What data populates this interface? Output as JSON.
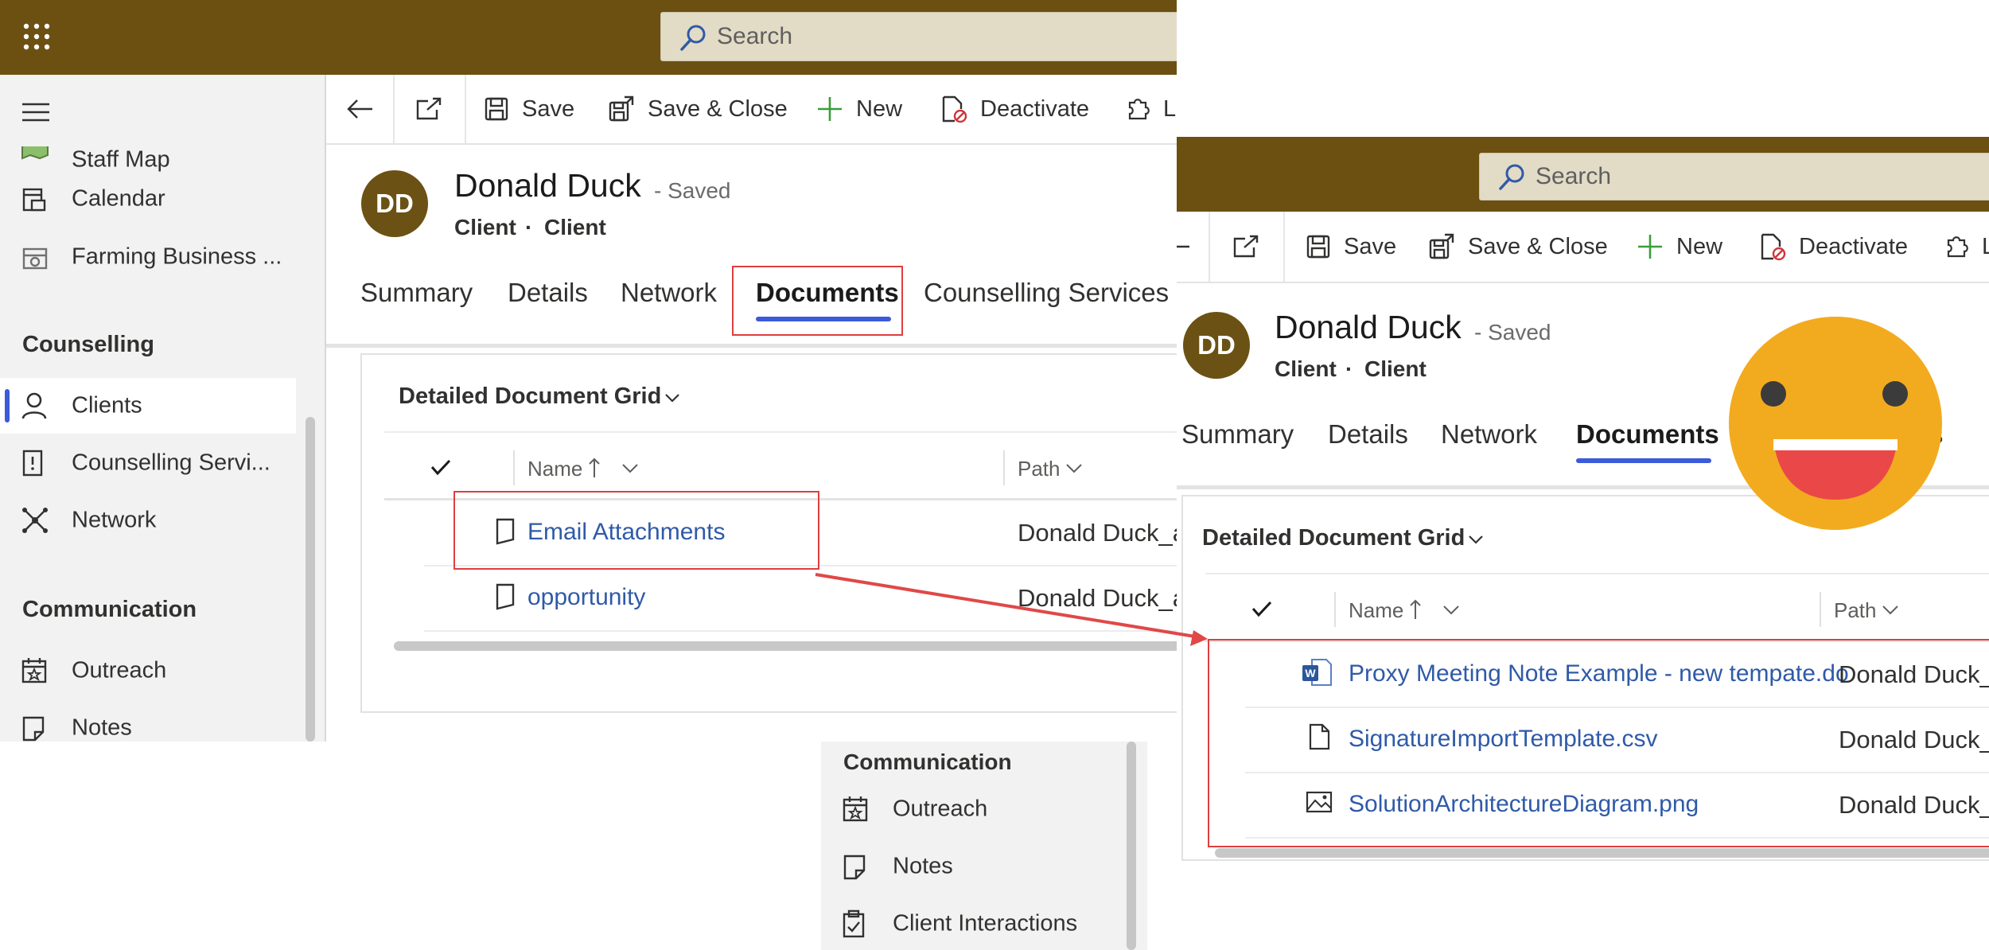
{
  "left": {
    "search_placeholder": "Search",
    "sidebar": {
      "top_items": [
        {
          "label": "Staff Map",
          "icon": "map-icon"
        },
        {
          "label": "Calendar",
          "icon": "calendar-icon"
        },
        {
          "label": "Farming Business ...",
          "icon": "business-icon"
        }
      ],
      "groups": [
        {
          "title": "Counselling",
          "items": [
            {
              "label": "Clients",
              "icon": "person-icon",
              "selected": true
            },
            {
              "label": "Counselling Servi...",
              "icon": "document-alert-icon"
            },
            {
              "label": "Network",
              "icon": "network-icon"
            }
          ]
        },
        {
          "title": "Communication",
          "items": [
            {
              "label": "Outreach",
              "icon": "calendar-star-icon"
            },
            {
              "label": "Notes",
              "icon": "note-icon"
            }
          ]
        }
      ]
    },
    "commands": {
      "save": "Save",
      "save_close": "Save & Close",
      "new": "New",
      "deactivate": "Deactivate",
      "more": "Li"
    },
    "record": {
      "initials": "DD",
      "name": "Donald Duck",
      "saved": "- Saved",
      "entity": "Client",
      "form": "Client",
      "separator": "·"
    },
    "tabs": [
      "Summary",
      "Details",
      "Network",
      "Documents",
      "Counselling Services"
    ],
    "active_tab": "Documents",
    "grid": {
      "title": "Detailed Document Grid",
      "columns": {
        "name": "Name",
        "path": "Path"
      },
      "rows": [
        {
          "name": "Email Attachments",
          "path": "Donald Duck_a"
        },
        {
          "name": "opportunity",
          "path": "Donald Duck_a"
        }
      ]
    }
  },
  "snippet": {
    "group_title": "Communication",
    "items": [
      {
        "label": "Outreach",
        "icon": "calendar-star-icon"
      },
      {
        "label": "Notes",
        "icon": "note-icon"
      },
      {
        "label": "Client Interactions",
        "icon": "clipboard-icon"
      }
    ]
  },
  "right": {
    "search_placeholder": "Search",
    "commands": {
      "save": "Save",
      "save_close": "Save & Close",
      "new": "New",
      "deactivate": "Deactivate",
      "more": "L"
    },
    "record": {
      "initials": "DD",
      "name": "Donald Duck",
      "saved": "- Saved",
      "entity": "Client",
      "form": "Client",
      "separator": "·"
    },
    "tabs": [
      "Summary",
      "Details",
      "Network",
      "Documents",
      "ces"
    ],
    "active_tab": "Documents",
    "grid": {
      "title": "Detailed Document Grid",
      "columns": {
        "name": "Name",
        "path": "Path"
      },
      "rows": [
        {
          "name": "Proxy Meeting Note Example - new tempate.do",
          "path": "Donald Duck_",
          "icon": "word-doc-icon"
        },
        {
          "name": "SignatureImportTemplate.csv",
          "path": "Donald Duck_",
          "icon": "file-icon"
        },
        {
          "name": "SolutionArchitectureDiagram.png",
          "path": "Donald Duck_",
          "icon": "image-icon"
        }
      ]
    }
  },
  "colors": {
    "topbar": "#6b5012",
    "accent": "#3b5bdb",
    "highlight_box": "#e03e3e",
    "arrow": "#e04848",
    "emoji_face": "#f2ab1f",
    "emoji_mouth": "#ea4848",
    "link": "#2f5aa8"
  }
}
